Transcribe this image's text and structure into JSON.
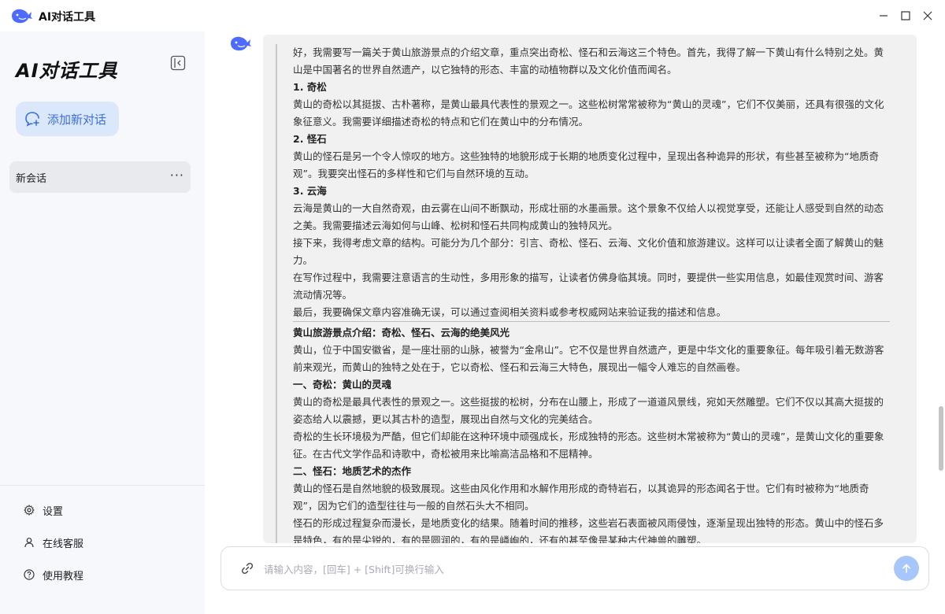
{
  "titlebar": {
    "app_title": "AI对话工具",
    "logo_icon": "whale-icon",
    "minimize_icon": "minimize-icon",
    "maximize_icon": "maximize-icon",
    "close_icon": "close-icon"
  },
  "sidebar": {
    "brand": "AI对话工具",
    "new_chat_label": "添加新对话",
    "sessions": [
      {
        "label": "新会话",
        "more": "···"
      }
    ],
    "menu": [
      {
        "label": "设置",
        "icon": "gear-icon"
      },
      {
        "label": "在线客服",
        "icon": "user-icon"
      },
      {
        "label": "使用教程",
        "icon": "help-icon"
      }
    ]
  },
  "chat": {
    "thinking": [
      {
        "text": "好，我需要写一篇关于黄山旅游景点的介绍文章，重点突出奇松、怪石和云海这三个特色。首先，我得了解一下黄山有什么特别之处。黄山是中国著名的世界自然遗产，以它独特的形态、丰富的动植物群以及文化价值而闻名。",
        "bold": false
      },
      {
        "text": "1. 奇松",
        "bold": true
      },
      {
        "text": "黄山的奇松以其挺拔、古朴著称，是黄山最具代表性的景观之一。这些松树常常被称为“黄山的灵魂”，它们不仅美丽，还具有很强的文化象征意义。我需要详细描述奇松的特点和它们在黄山中的分布情况。",
        "bold": false
      },
      {
        "text": "2. 怪石",
        "bold": true
      },
      {
        "text": "黄山的怪石是另一个令人惊叹的地方。这些独特的地貌形成于长期的地质变化过程中，呈现出各种诡异的形状，有些甚至被称为“地质奇观”。我要突出怪石的多样性和它们与自然环境的互动。",
        "bold": false
      },
      {
        "text": "3. 云海",
        "bold": true
      },
      {
        "text": "云海是黄山的一大自然奇观，由云雾在山间不断飘动，形成壮丽的水墨画景。这个景象不仅给人以视觉享受，还能让人感受到自然的动态之美。我需要描述云海如何与山峰、松树和怪石共同构成黄山的独特风光。",
        "bold": false
      },
      {
        "text": "接下来，我得考虑文章的结构。可能分为几个部分：引言、奇松、怪石、云海、文化价值和旅游建议。这样可以让读者全面了解黄山的魅力。",
        "bold": false
      },
      {
        "text": "在写作过程中，我需要注意语言的生动性，多用形象的描写，让读者仿佛身临其境。同时，要提供一些实用信息，如最佳观赏时间、游客流动情况等。",
        "bold": false
      },
      {
        "text": "最后，我要确保文章内容准确无误，可以通过查阅相关资料或参考权威网站来验证我的描述和信息。",
        "bold": false
      }
    ],
    "answer": [
      {
        "text": "黄山旅游景点介绍：奇松、怪石、云海的绝美风光",
        "bold": true
      },
      {
        "text": "黄山，位于中国安徽省，是一座壮丽的山脉，被誉为“金帛山”。它不仅是世界自然遗产，更是中华文化的重要象征。每年吸引着无数游客前来观光，而黄山的独特之处在于，它以奇松、怪石和云海三大特色，展现出一幅令人难忘的自然画卷。",
        "bold": false
      },
      {
        "text": "一、奇松：黄山的灵魂",
        "bold": true
      },
      {
        "text": "黄山的奇松是最具代表性的景观之一。这些挺拔的松树，分布在山腰上，形成了一道道风景线，宛如天然雕塑。它们不仅以其高大挺拔的姿态给人以震撼，更以其古朴的造型，展现出自然与文化的完美结合。",
        "bold": false
      },
      {
        "text": "奇松的生长环境极为严酷，但它们却能在这种环境中顽强成长，形成独特的形态。这些树木常被称为“黄山的灵魂”，是黄山文化的重要象征。在古代文学作品和诗歌中，奇松被用来比喻高洁品格和不屈精神。",
        "bold": false
      },
      {
        "text": "二、怪石：地质艺术的杰作",
        "bold": true
      },
      {
        "text": "黄山的怪石是自然地貌的极致展现。这些由风化作用和水解作用形成的奇特岩石，以其诡异的形态闻名于世。它们有时被称为“地质奇观”，因为它们的造型往往与一般的自然石头大不相同。",
        "bold": false
      },
      {
        "text": "怪石的形成过程复杂而漫长，是地质变化的结果。随着时间的推移，这些岩石表面被风雨侵蚀，逐渐呈现出独特的形态。黄山中的怪石多是特色，有的是尖锐的，有的是圆润的，有的是嶙峋的，还有的甚至像是某种古代神兽的雕塑。",
        "bold": false
      }
    ],
    "avatar_icon": "whale-icon"
  },
  "input": {
    "placeholder": "请输入内容，[回车] + [Shift]可换行输入",
    "link_icon": "link-icon",
    "send_icon": "arrow-up-icon"
  },
  "colors": {
    "accent": "#3b6fe0",
    "new_chat_bg": "#dbe8fb",
    "send_button": "#a7c6fb",
    "card_bg": "#f1f1f1",
    "sidebar_bg": "#f7f8fb"
  }
}
